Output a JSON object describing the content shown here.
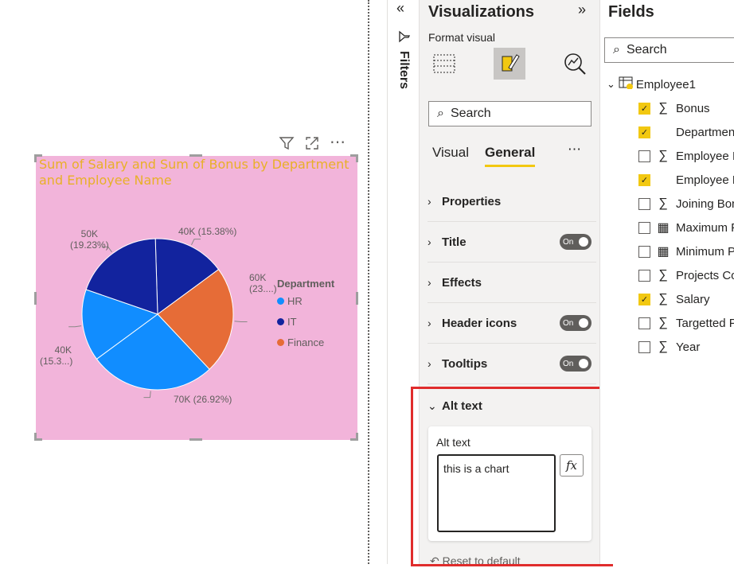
{
  "visual": {
    "title": "Sum of Salary and Sum of Bonus by Department and Employee Name",
    "header_icons": [
      "filter-icon",
      "focus-mode-icon",
      "more-options-icon"
    ]
  },
  "chart_data": {
    "type": "pie",
    "title": "Sum of Salary and Sum of Bonus by Department and Employee Name",
    "legend_title": "Department",
    "legend_position": "right",
    "legend": [
      {
        "name": "HR",
        "color": "#118dff"
      },
      {
        "name": "IT",
        "color": "#12239e"
      },
      {
        "name": "Finance",
        "color": "#e66c37"
      }
    ],
    "slices": [
      {
        "department": "IT",
        "value": 40000,
        "percent": 15.38,
        "label": "40K (15.38%)",
        "color": "#12239e"
      },
      {
        "department": "Finance",
        "value": 60000,
        "percent": 23.08,
        "label_line1": "60K",
        "label_line2": "(23....)",
        "color": "#e66c37"
      },
      {
        "department": "HR",
        "value": 70000,
        "percent": 26.92,
        "label": "70K (26.92%)",
        "color": "#118dff"
      },
      {
        "department": "HR",
        "value": 40000,
        "percent": 15.38,
        "label_line1": "40K",
        "label_line2": "(15.3...)",
        "color": "#118dff"
      },
      {
        "department": "IT",
        "value": 50000,
        "percent": 19.23,
        "label_line1": "50K",
        "label_line2": "(19.23%)",
        "color": "#12239e"
      }
    ]
  },
  "filters": {
    "label": "Filters"
  },
  "visualizations": {
    "title": "Visualizations",
    "format_visual": "Format visual",
    "search_placeholder": "Search",
    "tabs": [
      "Visual",
      "General"
    ],
    "sections": [
      {
        "label": "Properties",
        "toggle": null
      },
      {
        "label": "Title",
        "toggle": "On"
      },
      {
        "label": "Effects",
        "toggle": null
      },
      {
        "label": "Header icons",
        "toggle": "On"
      },
      {
        "label": "Tooltips",
        "toggle": "On"
      },
      {
        "label": "Alt text",
        "toggle": null
      }
    ],
    "alt_text": {
      "label": "Alt text",
      "value": "this is a chart",
      "fx": "fx",
      "reset": "Reset to default"
    }
  },
  "fields": {
    "title": "Fields",
    "search_placeholder": "Search",
    "table": "Employee1",
    "items": [
      {
        "name": "Bonus",
        "checked": true,
        "icon": "sigma"
      },
      {
        "name": "Department",
        "checked": true,
        "icon": "none"
      },
      {
        "name": "Employee ID",
        "checked": false,
        "icon": "sigma"
      },
      {
        "name": "Employee Name",
        "checked": true,
        "icon": "none"
      },
      {
        "name": "Joining Bonus",
        "checked": false,
        "icon": "sigma"
      },
      {
        "name": "Maximum F",
        "checked": false,
        "icon": "calculator"
      },
      {
        "name": "Minimum P",
        "checked": false,
        "icon": "calculator"
      },
      {
        "name": "Projects Co",
        "checked": false,
        "icon": "sigma"
      },
      {
        "name": "Salary",
        "checked": true,
        "icon": "sigma"
      },
      {
        "name": "Targetted P",
        "checked": false,
        "icon": "sigma"
      },
      {
        "name": "Year",
        "checked": false,
        "icon": "sigma"
      }
    ]
  }
}
